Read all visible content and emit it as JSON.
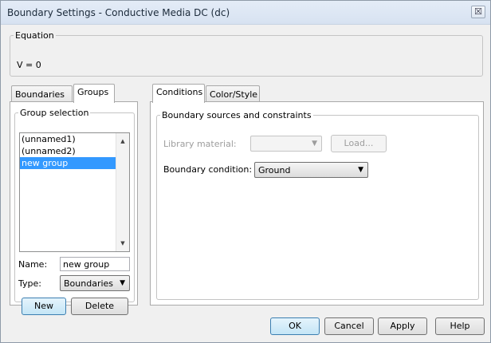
{
  "window": {
    "title": "Boundary Settings - Conductive Media DC (dc)",
    "close_glyph": "☒"
  },
  "equation": {
    "legend": "Equation",
    "text": "V = 0"
  },
  "left_tabs": [
    "Boundaries",
    "Groups"
  ],
  "group_selection": {
    "legend": "Group selection",
    "items": [
      "(unnamed1)",
      "(unnamed2)",
      "new group"
    ],
    "selected_index": 2,
    "name_label": "Name:",
    "name_value": "new group",
    "type_label": "Type:",
    "type_value": "Boundaries",
    "new_button": "New",
    "delete_button": "Delete"
  },
  "right_tabs": [
    "Conditions",
    "Color/Style"
  ],
  "conditions": {
    "legend": "Boundary sources and constraints",
    "library_label": "Library material:",
    "library_value": "",
    "load_button": "Load...",
    "bc_label": "Boundary condition:",
    "bc_value": "Ground"
  },
  "footer": {
    "ok": "OK",
    "cancel": "Cancel",
    "apply": "Apply",
    "help": "Help"
  }
}
